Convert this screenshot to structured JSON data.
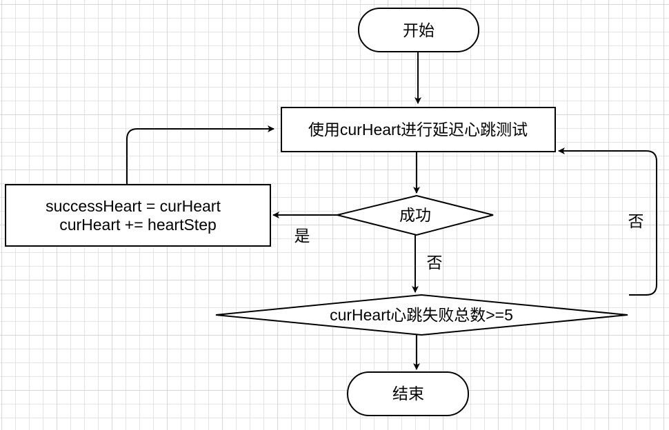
{
  "nodes": {
    "start": {
      "label": "开始"
    },
    "test": {
      "label": "使用curHeart进行延迟心跳测试"
    },
    "success": {
      "label": "成功"
    },
    "update": {
      "line1": "successHeart = curHeart",
      "line2": "curHeart += heartStep"
    },
    "fail_check": {
      "label": "curHeart心跳失败总数>=5"
    },
    "end": {
      "label": "结束"
    }
  },
  "edge_labels": {
    "yes": "是",
    "no_down": "否",
    "no_loop": "否"
  },
  "colors": {
    "stroke": "#000000",
    "fill": "#ffffff",
    "grid": "#e4e4e4"
  }
}
